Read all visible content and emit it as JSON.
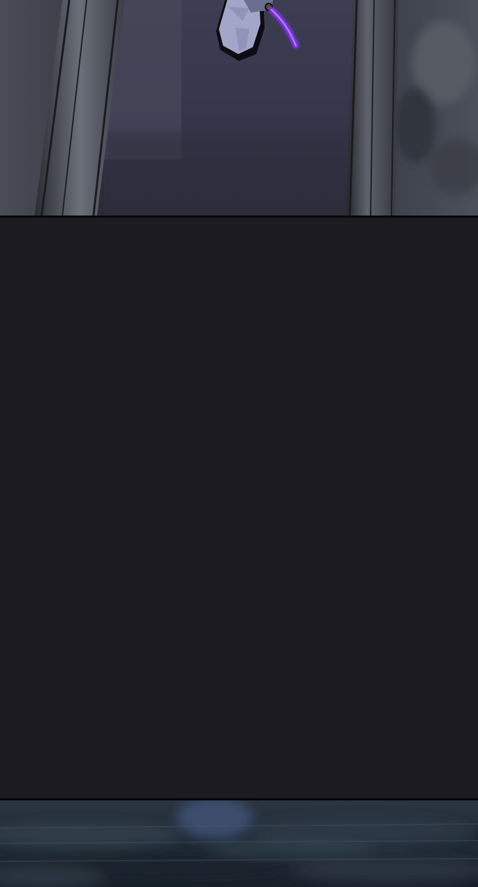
{
  "reader": {
    "background_color": "#1b1b21",
    "panel_border_color": "#07070a"
  },
  "panels": [
    {
      "id": "top",
      "scene": "doorway-with-swordsman",
      "palette": {
        "wall": "#3a3b49",
        "door_frame": "#6a6e78",
        "figure_robe": "#9ea0c4",
        "sword_glow": "#8f3cff"
      }
    },
    {
      "id": "bottom",
      "scene": "blurred-motion-ground",
      "palette": {
        "ground": "#243039",
        "highlight": "#3a4a68"
      }
    }
  ]
}
